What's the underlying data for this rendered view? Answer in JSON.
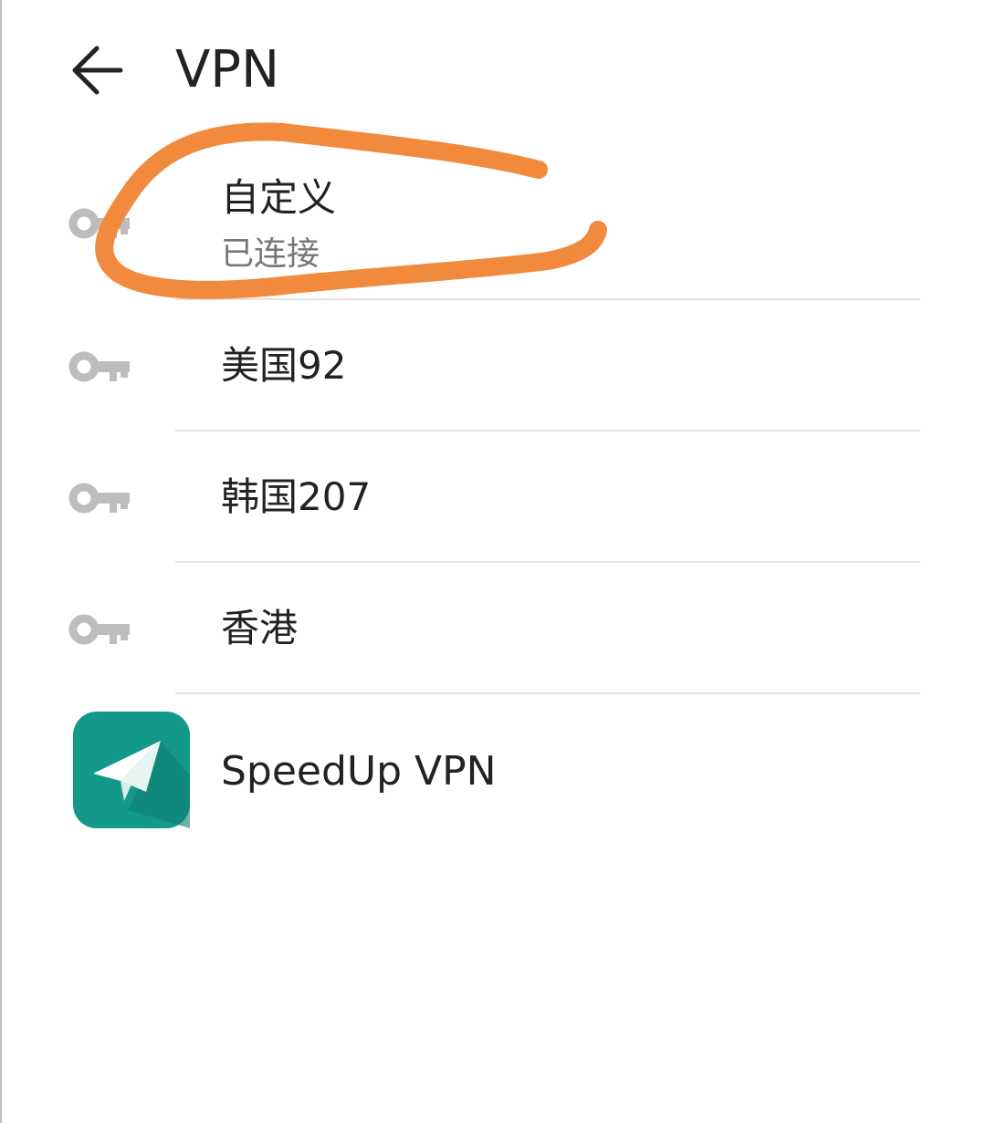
{
  "app_bar": {
    "title": "VPN",
    "back_icon": "arrow-left-icon"
  },
  "vpn_list": [
    {
      "name": "自定义",
      "status": "已连接",
      "icon": "key-icon"
    },
    {
      "name": "美国92",
      "icon": "key-icon"
    },
    {
      "name": "韩国207",
      "icon": "key-icon"
    },
    {
      "name": "香港",
      "icon": "key-icon"
    }
  ],
  "third_party_app": {
    "name": "SpeedUp VPN",
    "icon": "paper-plane-icon",
    "icon_color": "#13998a"
  },
  "colors": {
    "key_icon": "#bdbdbd",
    "annotation": "#f28a3e",
    "divider": "#e3e3e3"
  }
}
